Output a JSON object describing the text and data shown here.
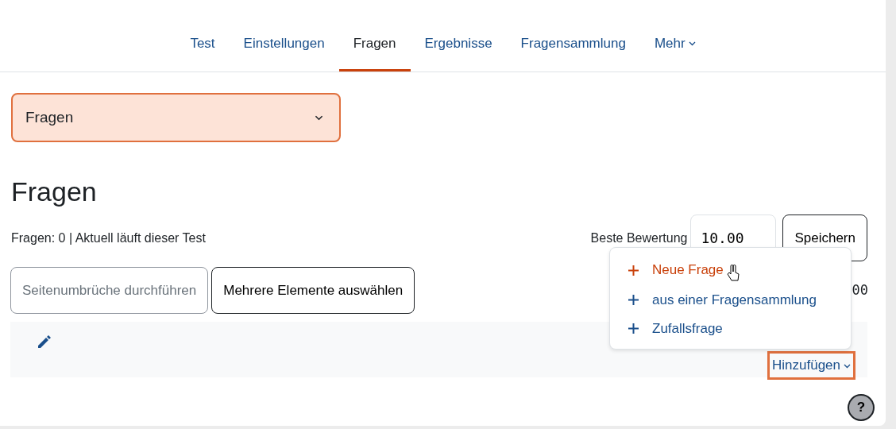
{
  "tabs": [
    {
      "label": "Test",
      "selected": false
    },
    {
      "label": "Einstellungen",
      "selected": false
    },
    {
      "label": "Fragen",
      "selected": true
    },
    {
      "label": "Ergebnisse",
      "selected": false
    },
    {
      "label": "Fragensammlung",
      "selected": false
    },
    {
      "label": "Mehr",
      "selected": false,
      "dropdown": true
    }
  ],
  "page_select": {
    "value": "Fragen",
    "highlighted": true
  },
  "heading": "Fragen",
  "info": "Fragen: 0 | Aktuell läuft dieser Test",
  "max_grade": {
    "label": "Beste Bewertung",
    "value": "10.00",
    "button": "Speichern"
  },
  "buttons": [
    {
      "label": "Seitenumbrüche durchführen",
      "disabled": true
    },
    {
      "label": "Mehrere Elemente auswählen",
      "disabled": false
    }
  ],
  "total_partial": "00",
  "help": "?",
  "add_menu": {
    "label": "Hinzufügen",
    "highlighted": true,
    "items": [
      {
        "label": "Neue Frage",
        "selected": true
      },
      {
        "label": "aus einer Fragensammlung",
        "selected": false
      },
      {
        "label": "Zufallsfrage",
        "selected": false
      }
    ]
  }
}
